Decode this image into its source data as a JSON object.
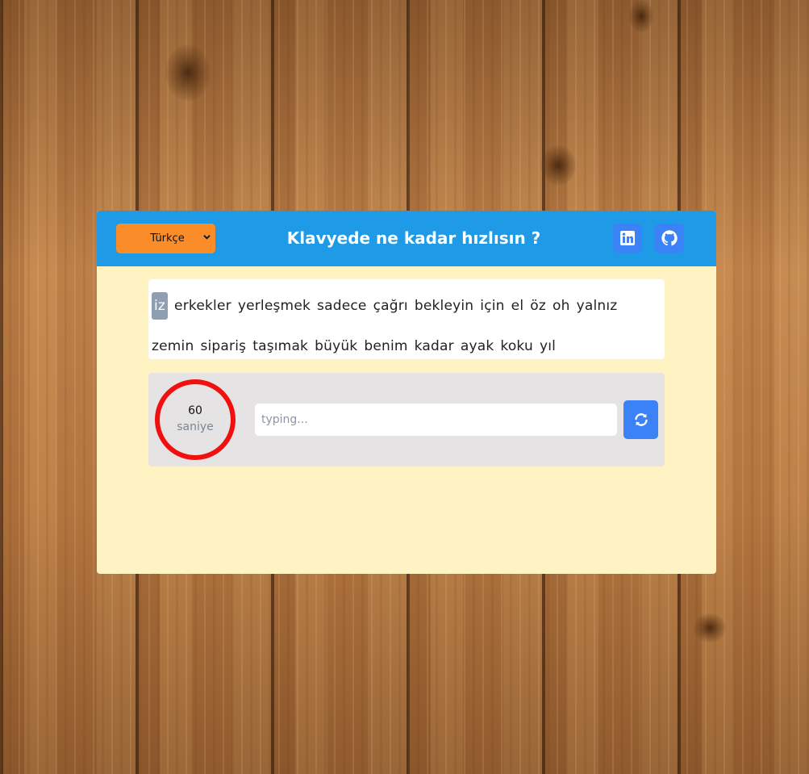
{
  "header": {
    "language_selected": "Türkçe",
    "title": "Klavyede ne kadar hızlısın ?",
    "linkedin_icon": "linkedin-icon",
    "github_icon": "github-icon"
  },
  "words": {
    "line1": [
      "iz",
      "erkekler",
      "yerleşmek",
      "sadece",
      "çağrı",
      "bekleyin",
      "için",
      "el",
      "öz",
      "oh",
      "yalnız"
    ],
    "line2": [
      "zemin",
      "sipariş",
      "taşımak",
      "büyük",
      "benim",
      "kadar",
      "ayak",
      "koku",
      "yıl"
    ],
    "active_index": 0
  },
  "timer": {
    "value": "60",
    "unit": "saniye"
  },
  "input": {
    "placeholder": "typing...",
    "value": ""
  },
  "refresh_icon": "refresh-icon",
  "colors": {
    "header_bg": "#1e9ae6",
    "card_bg": "#fff3c3",
    "select_bg": "#fa8c2a",
    "button_bg": "#3b82f6",
    "timer_ring": "#f01010",
    "active_word_bg": "#8f9eb0"
  }
}
